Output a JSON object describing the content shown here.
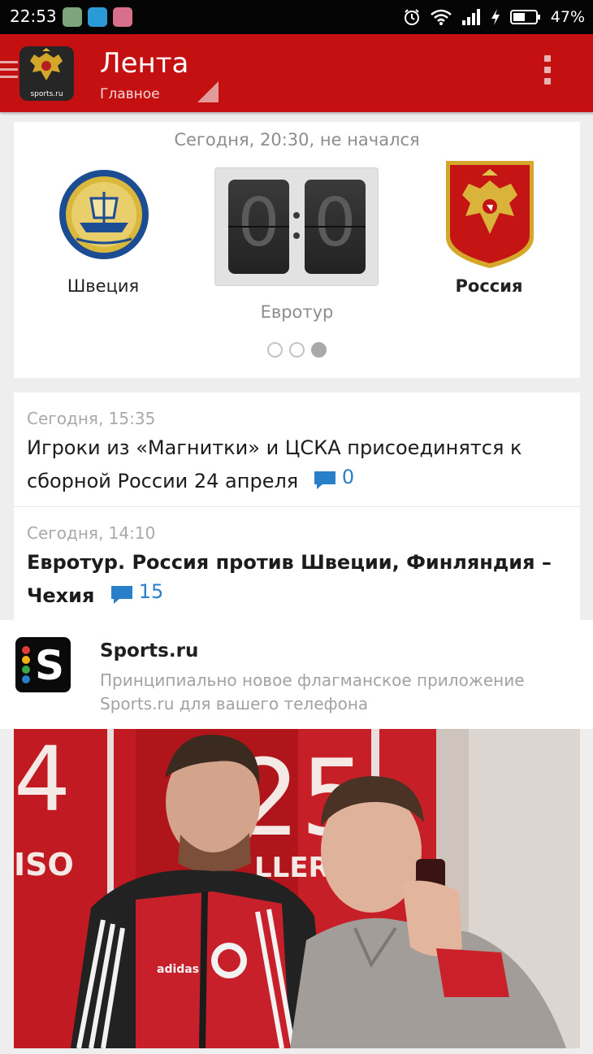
{
  "status_bar": {
    "time": "22:53",
    "battery": "47%",
    "icons": [
      "alarm-icon",
      "wifi-icon",
      "signal-icon",
      "charging-icon",
      "battery-icon"
    ],
    "notifications": [
      "notif-app-green",
      "notif-app-blue",
      "notif-app-pink"
    ]
  },
  "app_bar": {
    "title": "Лента",
    "subtitle": "Главное",
    "logo_caption": "sports.ru",
    "color": "#c41010"
  },
  "match": {
    "meta": "Сегодня, 20:30, не начался",
    "home_team": "Швеция",
    "away_team": "Россия",
    "home_score": "0",
    "away_score": "0",
    "tournament": "Евротур",
    "pager": {
      "count": 3,
      "active": 3
    }
  },
  "news": [
    {
      "time": "Сегодня, 15:35",
      "title": "Игроки из «Магнитки» и ЦСКА присоединятся к сборной России 24 апреля",
      "comments": "0",
      "bold": false
    },
    {
      "time": "Сегодня, 14:10",
      "title": "Евротур. Россия против Швеции, Финляндия – Чехия",
      "comments": "15",
      "bold": true
    }
  ],
  "promo": {
    "title": "Sports.ru",
    "description": "Принципиально новое флагманское приложение Sports.ru для вашего телефона"
  },
  "photo": {
    "locker_texts": [
      "4",
      "25",
      "ISO",
      "LLER"
    ],
    "jacket_brand": "adidas"
  },
  "colors": {
    "accent_blue": "#2a7fc9",
    "page_bg": "#eeeeee"
  }
}
